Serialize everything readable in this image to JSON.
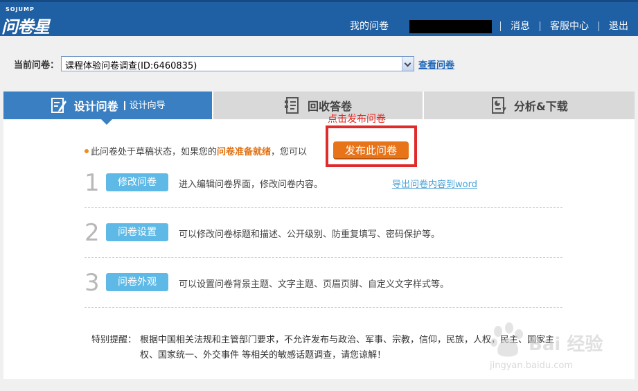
{
  "brand": {
    "small": "SOJUMP",
    "name": "问卷星"
  },
  "topnav": {
    "my_surveys": "我的问卷",
    "messages": "消息",
    "support": "客服中心",
    "logout": "退出"
  },
  "current_survey": {
    "label": "当前问卷：",
    "selected": "课程体验问卷调查(ID:6460835)",
    "view_link": "查看问卷"
  },
  "tabs": [
    {
      "label": "设计问卷",
      "sub": "设计向导",
      "icon": "edit-document-icon"
    },
    {
      "label": "回收答卷",
      "icon": "collect-document-icon"
    },
    {
      "label": "分析&下载",
      "icon": "analysis-download-icon"
    }
  ],
  "annotation": "点击发布问卷",
  "status": {
    "prefix": "此问卷处于草稿状态，如果您的",
    "highlight": "问卷准备就绪",
    "suffix": "，您可以",
    "publish_button": "发布此问卷"
  },
  "steps": [
    {
      "num": "1",
      "button": "修改问卷",
      "desc": "进入编辑问卷界面，修改问卷内容。",
      "link": "导出问卷内容到word"
    },
    {
      "num": "2",
      "button": "问卷设置",
      "desc": "可以修改问卷标题和描述、公开级别、防重复填写、密码保护等。"
    },
    {
      "num": "3",
      "button": "问卷外观",
      "desc": "可以设置问卷背景主题、文字主题、页眉页脚、自定义文字样式等。"
    }
  ],
  "notice": {
    "label": "特别提醒：",
    "text": "根据中国相关法规和主管部门要求，不允许发布与政治、军事、宗教，信仰，民族，人权，民主、国家主权、国家统一、外交事件 等相关的敏感话题调查，请您谅解！"
  },
  "watermark": {
    "text": "Bai 经验",
    "url": "jingyan.baidu.com"
  },
  "colors": {
    "header": "#1f5fa3",
    "active_tab": "#3a7fc1",
    "publish": "#e8741a",
    "step_button": "#5fb9e6",
    "annotation": "#e02b2b"
  }
}
